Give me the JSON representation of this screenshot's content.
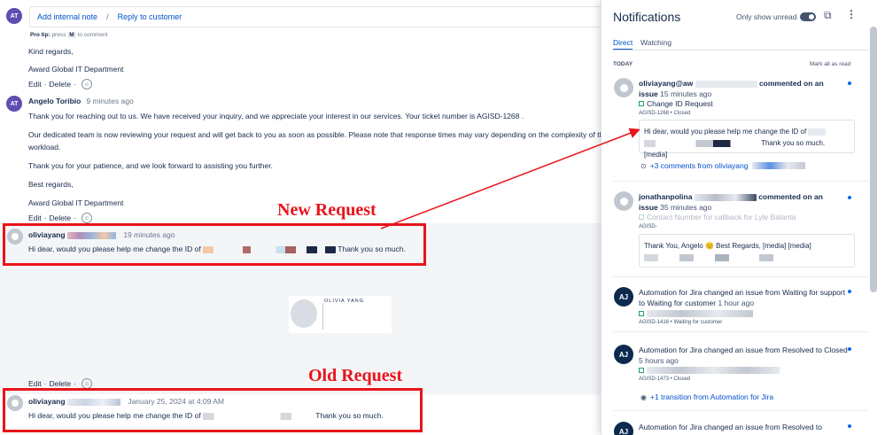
{
  "composer": {
    "avatar_initials": "AT",
    "add_internal_note": "Add internal note",
    "separator": "/",
    "reply_to_customer": "Reply to customer",
    "protip_label": "Pro tip:",
    "protip_press": "press",
    "protip_key": "M",
    "protip_rest": "to comment"
  },
  "thread": {
    "prev": {
      "line1": "Kind regards,",
      "line2": "Award Global IT Department",
      "actions": {
        "edit": "Edit",
        "delete": "Delete"
      }
    },
    "angelo": {
      "avatar_initials": "AT",
      "author": "Angelo Toribio",
      "time": "9 minutes ago",
      "p1": "Thank you for reaching out to us. We have received your inquiry, and we appreciate your interest in our services. Your ticket number is AGISD-1268 .",
      "p2a": "Our dedicated team is now reviewing your request and will get back to you as soon as possible. Please note that response times may vary depending on the complexity of the issue ar",
      "p2b": "workload.",
      "p3": "Thank you for your patience, and we look forward to assisting you further.",
      "p4": "Best regards,",
      "p5": "Award Global IT Department",
      "actions": {
        "edit": "Edit",
        "delete": "Delete"
      }
    },
    "new_request": {
      "author": "oliviayang",
      "time": "19 minutes ago",
      "text_start": "Hi dear, would you please help me change the ID of",
      "text_end": "Thank you so much.",
      "card_name": "OLIVIA YANG",
      "actions": {
        "edit": "Edit",
        "delete": "Delete"
      }
    },
    "old_request": {
      "author": "oliviayang",
      "time": "January 25, 2024 at 4:09 AM",
      "text_start": "Hi dear, would you please help me change the ID of",
      "text_end": "Thank you so much."
    }
  },
  "annotations": {
    "new_label": "New Request",
    "old_label": "Old Request",
    "color": "#e8141b"
  },
  "notifications": {
    "title": "Notifications",
    "only_unread": "Only show unread",
    "tabs": [
      "Direct",
      "Watching"
    ],
    "section": "TODAY",
    "mark_all": "Mark all as read",
    "items": [
      {
        "actor": "oliviayang@aw",
        "action": "commented on an",
        "action2": "issue",
        "time": "15 minutes ago",
        "issue_title": "Change ID Request",
        "issue_meta": "AGISD-1268 • Closed",
        "quote_start": "Hi dear, would you please help me change the ID of",
        "quote_end": "Thank you so much. [media]",
        "more": "+3 comments from oliviayang"
      },
      {
        "actor": "jonathanpolina",
        "action": "commented on an",
        "action2": "issue",
        "time": "35 minutes ago",
        "issue_title": "Contact Number for callback for Lyle Balanta",
        "issue_meta": "AGISD-",
        "quote": "Thank You, Angelo 😊 Best Regards, [media] [media]"
      },
      {
        "avatar_initials": "AJ",
        "text": "Automation for Jira changed an issue from Waiting for support to Waiting for customer",
        "time": "1 hour ago",
        "issue_meta": "AGISD-1416 • Waiting for customer"
      },
      {
        "avatar_initials": "AJ",
        "text": "Automation for Jira changed an issue from Resolved to Closed",
        "time": "5 hours ago",
        "issue_meta": "AGISD-1473 • Closed",
        "more": "+1 transition from Automation for Jira"
      },
      {
        "avatar_initials": "AJ",
        "text": "Automation for Jira changed an issue from Resolved to"
      }
    ]
  },
  "colors": {
    "accent": "#0052cc",
    "automation_avatar": "#0c2a4d",
    "unread_dot": "#0c66e4"
  },
  "icons": [
    "emoji-icon",
    "toggle-switch",
    "open-new-window-icon",
    "more-options-icon",
    "check-square-icon",
    "comments-icon",
    "transition-icon"
  ]
}
